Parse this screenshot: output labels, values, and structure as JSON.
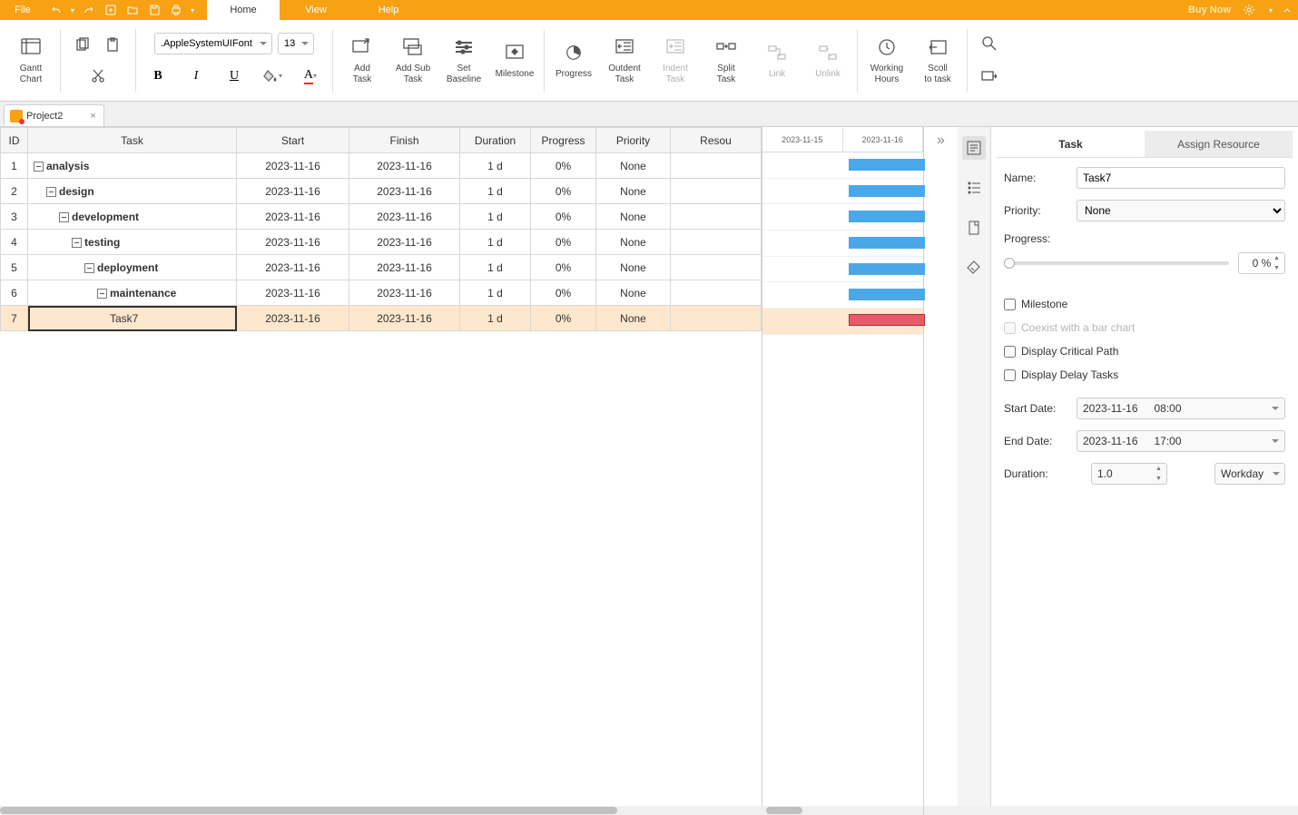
{
  "menu": {
    "file": "File",
    "tabs": [
      "Home",
      "View",
      "Help"
    ],
    "activeTab": 0,
    "buyNow": "Buy Now"
  },
  "ribbon": {
    "ganttChart": "Gantt\nChart",
    "fontName": ".AppleSystemUIFont",
    "fontSize": "13",
    "buttons": {
      "addTask": "Add\nTask",
      "addSubTask": "Add Sub\nTask",
      "setBaseline": "Set\nBaseline",
      "milestone": "Milestone",
      "progress": "Progress",
      "outdent": "Outdent\nTask",
      "indent": "Indent\nTask",
      "split": "Split\nTask",
      "link": "Link",
      "unlink": "Unlink",
      "workingHours": "Working\nHours",
      "scrollToTask": "Scoll\nto task"
    }
  },
  "docTab": {
    "name": "Project2"
  },
  "grid": {
    "headers": [
      "ID",
      "Task",
      "Start",
      "Finish",
      "Duration",
      "Progress",
      "Priority",
      "Resou"
    ],
    "rows": [
      {
        "id": "1",
        "name": "analysis",
        "indent": 0,
        "start": "2023-11-16",
        "finish": "2023-11-16",
        "dur": "1 d",
        "prog": "0%",
        "prio": "None",
        "bold": true
      },
      {
        "id": "2",
        "name": "design",
        "indent": 1,
        "start": "2023-11-16",
        "finish": "2023-11-16",
        "dur": "1 d",
        "prog": "0%",
        "prio": "None",
        "bold": true
      },
      {
        "id": "3",
        "name": "development",
        "indent": 2,
        "start": "2023-11-16",
        "finish": "2023-11-16",
        "dur": "1 d",
        "prog": "0%",
        "prio": "None",
        "bold": true
      },
      {
        "id": "4",
        "name": "testing",
        "indent": 3,
        "start": "2023-11-16",
        "finish": "2023-11-16",
        "dur": "1 d",
        "prog": "0%",
        "prio": "None",
        "bold": true
      },
      {
        "id": "5",
        "name": "deployment",
        "indent": 4,
        "start": "2023-11-16",
        "finish": "2023-11-16",
        "dur": "1 d",
        "prog": "0%",
        "prio": "None",
        "bold": true
      },
      {
        "id": "6",
        "name": "maintenance",
        "indent": 5,
        "start": "2023-11-16",
        "finish": "2023-11-16",
        "dur": "1 d",
        "prog": "0%",
        "prio": "None",
        "bold": true
      },
      {
        "id": "7",
        "name": "Task7",
        "indent": 6,
        "start": "2023-11-16",
        "finish": "2023-11-16",
        "dur": "1 d",
        "prog": "0%",
        "prio": "None",
        "bold": false,
        "selected": true,
        "noExpander": true
      }
    ]
  },
  "gantt": {
    "dates": [
      "2023-11-15",
      "2023-11-16"
    ]
  },
  "sidePanel": {
    "tabs": [
      "Task",
      "Assign Resource"
    ],
    "activeTab": 0,
    "labels": {
      "name": "Name:",
      "priority": "Priority:",
      "progress": "Progress:",
      "milestone": "Milestone",
      "coexist": "Coexist with a bar chart",
      "critical": "Display Critical Path",
      "delay": "Display Delay Tasks",
      "startDate": "Start Date:",
      "endDate": "End Date:",
      "duration": "Duration:"
    },
    "values": {
      "name": "Task7",
      "priority": "None",
      "progress": "0 %",
      "startDate": "2023-11-16",
      "startTime": "08:00",
      "endDate": "2023-11-16",
      "endTime": "17:00",
      "duration": "1.0",
      "durationUnit": "Workday"
    }
  }
}
